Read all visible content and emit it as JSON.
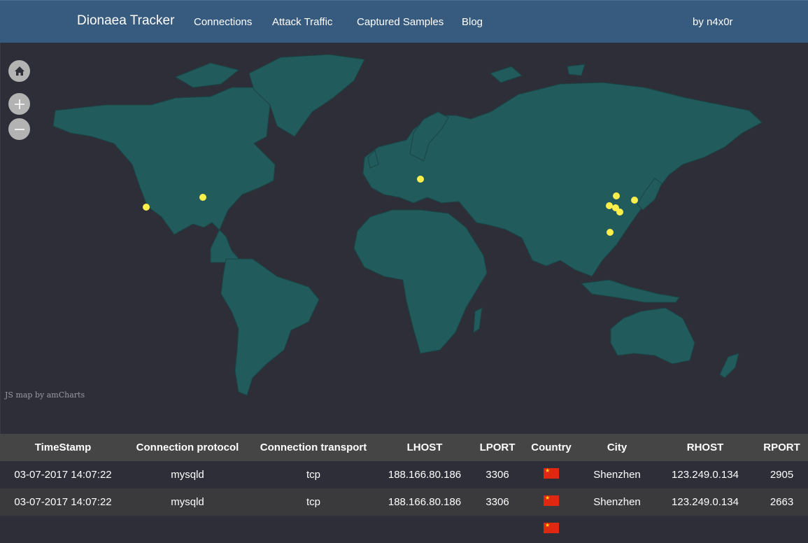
{
  "navbar": {
    "brand": "Dionaea Tracker",
    "links": [
      "Connections",
      "Attack Traffic",
      "Captured Samples",
      "Blog"
    ],
    "author": "by n4x0r"
  },
  "map": {
    "credit": "JS map by amCharts",
    "controls": [
      "home-icon",
      "zoom-in-icon",
      "zoom-out-icon"
    ],
    "land_color": "#215b5b",
    "marker_color": "#ffef4a",
    "markers_count": 9
  },
  "table": {
    "headers": [
      "TimeStamp",
      "Connection protocol",
      "Connection transport",
      "LHOST",
      "LPORT",
      "Country",
      "City",
      "RHOST",
      "RPORT"
    ],
    "rows": [
      [
        "03-07-2017 14:07:22",
        "mysqld",
        "tcp",
        "188.166.80.186",
        "3306",
        "CN",
        "Shenzhen",
        "123.249.0.134",
        "2905"
      ],
      [
        "03-07-2017 14:07:22",
        "mysqld",
        "tcp",
        "188.166.80.186",
        "3306",
        "CN",
        "Shenzhen",
        "123.249.0.134",
        "2663"
      ]
    ]
  },
  "colors": {
    "navbar": "#375a7f",
    "background": "#2e2e39",
    "header_row": "#464545",
    "flag_cn": "#de2910"
  }
}
